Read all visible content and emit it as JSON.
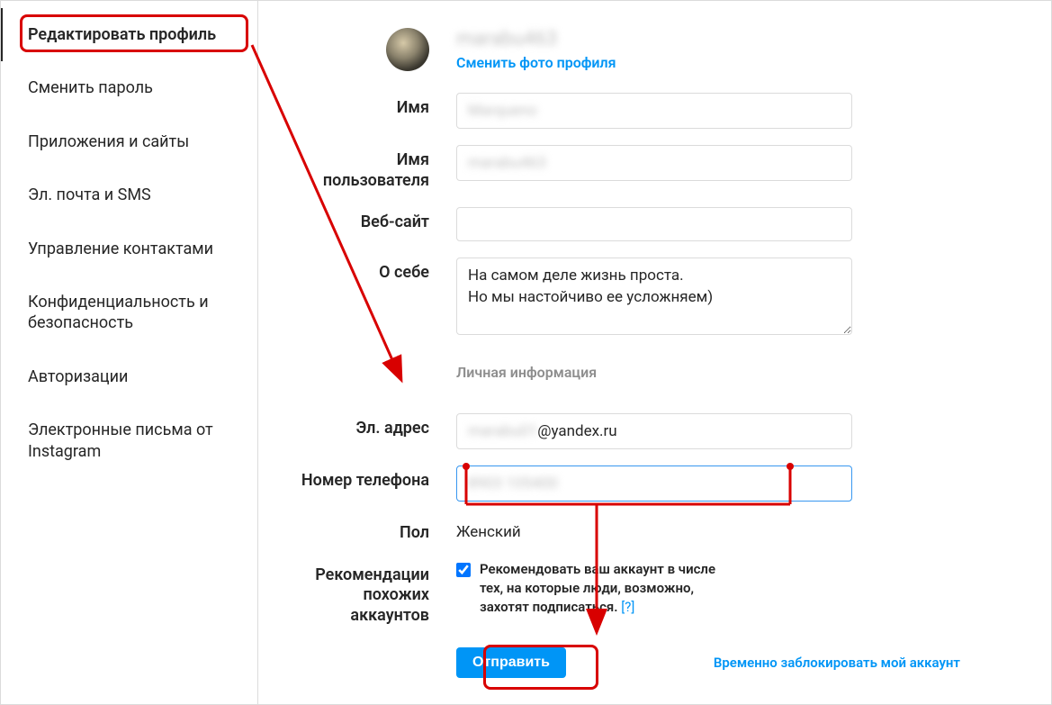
{
  "sidebar": {
    "items": [
      {
        "label": "Редактировать профиль",
        "active": true
      },
      {
        "label": "Сменить пароль",
        "active": false
      },
      {
        "label": "Приложения и сайты",
        "active": false
      },
      {
        "label": "Эл. почта и SMS",
        "active": false
      },
      {
        "label": "Управление контактами",
        "active": false
      },
      {
        "label": "Конфиденциальность и безопасность",
        "active": false
      },
      {
        "label": "Авторизации",
        "active": false
      },
      {
        "label": "Электронные письма от Instagram",
        "active": false
      }
    ]
  },
  "profile": {
    "username_display": "mаrаbu463",
    "change_photo_label": "Сменить фото профиля"
  },
  "form": {
    "name_label": "Имя",
    "name_value": "Mаrquеnо",
    "username_label": "Имя пользователя",
    "username_value": "mаrаbu463",
    "website_label": "Веб-сайт",
    "website_value": "",
    "bio_label": "О себе",
    "bio_value": "На самом деле жизнь проста.\nНо мы настойчиво ее усложняем)",
    "private_section": "Личная информация",
    "email_label": "Эл. адрес",
    "email_blurred": "mаrаbu01",
    "email_clear": "@yandex.ru",
    "phone_label": "Номер телефона",
    "phone_value": "8903 105400",
    "gender_label": "Пол",
    "gender_value": "Женский",
    "recs_label": "Рекомендации похожих аккаунтов",
    "recs_text": "Рекомендовать ваш аккаунт в числе тех, на которые люди, возможно, захотят подписаться. ",
    "recs_help": "[?]",
    "recs_checked": true,
    "submit_label": "Отправить",
    "disable_label": "Временно заблокировать мой аккаунт"
  }
}
